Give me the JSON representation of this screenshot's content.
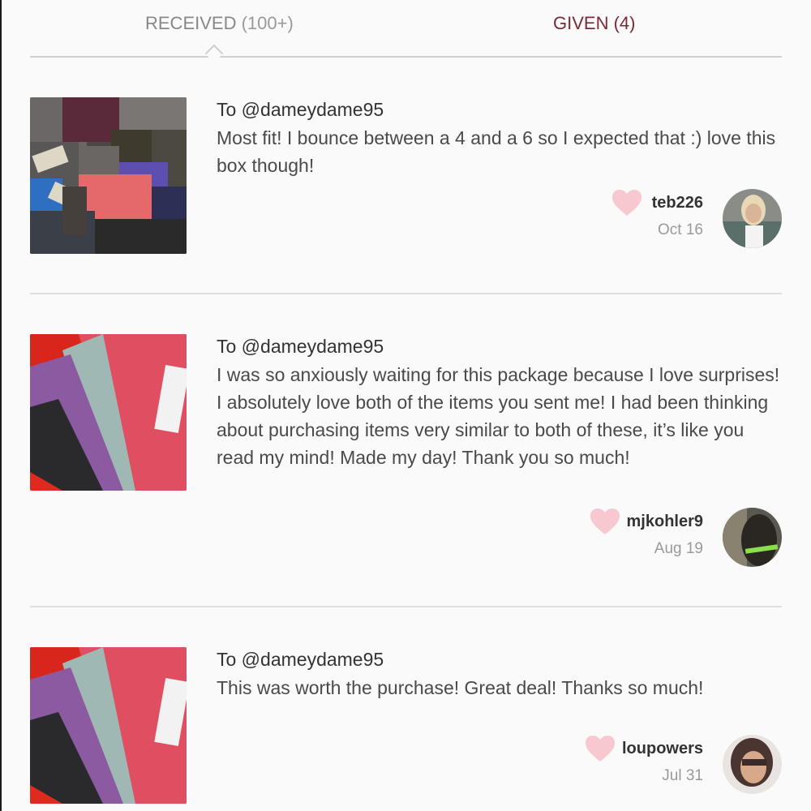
{
  "tabs": {
    "received": {
      "label": "RECEIVED",
      "count": "(100+)"
    },
    "given": {
      "label": "GIVEN (4)"
    }
  },
  "reviews": [
    {
      "to": "To @dameydame95",
      "message": "Most fit! I bounce between a 4 and a 6 so I expected that :) love this box though!",
      "username": "teb226",
      "date": "Oct 16",
      "image": "clothing-pile-photo",
      "avatar": "teb226-avatar"
    },
    {
      "to": "To @dameydame95",
      "message": "I was so anxiously waiting for this package because I love surprises! I absolutely love both of the items you sent me! I had been thinking about purchasing items very similar to both of these, it’s like you read my mind! Made my day! Thank you so much!",
      "username": "mjkohler9",
      "date": "Aug 19",
      "image": "leggings-photo",
      "avatar": "mjkohler9-avatar"
    },
    {
      "to": "To @dameydame95",
      "message": "This was worth the purchase! Great deal! Thanks so much!",
      "username": "loupowers",
      "date": "Jul 31",
      "image": "leggings-photo",
      "avatar": "loupowers-avatar"
    }
  ],
  "colors": {
    "heart": "#f8c8d0",
    "given_tab": "#7a2a35",
    "received_tab": "#888888",
    "background": "#fbfafb"
  },
  "icons": {
    "heart": "heart-icon",
    "caret": "caret-up-icon"
  }
}
